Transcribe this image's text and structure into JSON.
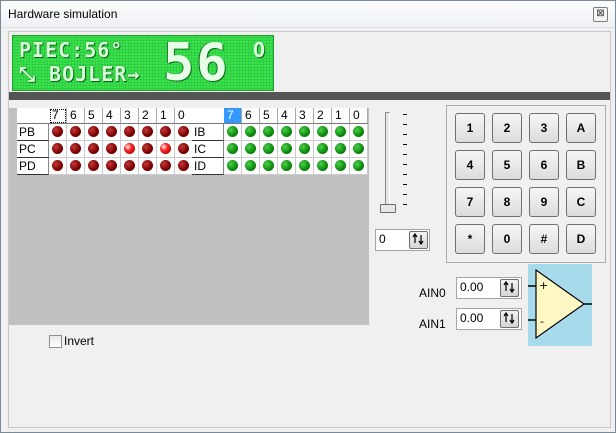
{
  "window": {
    "title": "Hardware simulation",
    "close_glyph": "⊠"
  },
  "lcd": {
    "line1": "PIEC:56°",
    "line2": "⤡ BOJLER→",
    "big_value": "56",
    "small_char": "O",
    "color": "#37e24a"
  },
  "ports_out": {
    "bits": [
      "7",
      "6",
      "5",
      "4",
      "3",
      "2",
      "1",
      "0"
    ],
    "rows": [
      {
        "name": "PB",
        "leds": [
          0,
          0,
          0,
          0,
          0,
          0,
          0,
          0
        ]
      },
      {
        "name": "PC",
        "leds": [
          0,
          0,
          0,
          0,
          1,
          0,
          1,
          0
        ]
      },
      {
        "name": "PD",
        "leds": [
          0,
          0,
          0,
          0,
          0,
          0,
          0,
          0
        ]
      }
    ],
    "focused_bit": "7"
  },
  "ports_in": {
    "bits": [
      "7",
      "6",
      "5",
      "4",
      "3",
      "2",
      "1",
      "0"
    ],
    "rows": [
      {
        "name": "IB",
        "leds": [
          1,
          1,
          1,
          1,
          1,
          1,
          1,
          1
        ]
      },
      {
        "name": "IC",
        "leds": [
          1,
          1,
          1,
          1,
          1,
          1,
          1,
          1
        ]
      },
      {
        "name": "ID",
        "leds": [
          1,
          1,
          1,
          1,
          1,
          1,
          1,
          1
        ]
      }
    ],
    "selected_bit": "7"
  },
  "invert": {
    "label": "Invert",
    "checked": false
  },
  "slider": {
    "value": "0",
    "level": 0
  },
  "keypad": {
    "keys": [
      "1",
      "2",
      "3",
      "A",
      "4",
      "5",
      "6",
      "B",
      "7",
      "8",
      "9",
      "C",
      "*",
      "0",
      "#",
      "D"
    ]
  },
  "analog": {
    "ain0": {
      "label": "AIN0",
      "value": "0.00"
    },
    "ain1": {
      "label": "AIN1",
      "value": "0.00"
    },
    "plus_sign": "+",
    "minus_sign": "-",
    "box_color": "#a7dbeb",
    "opamp_color": "#fff8c4"
  },
  "icons": {
    "spin_button": "updown-arrows-icon"
  }
}
